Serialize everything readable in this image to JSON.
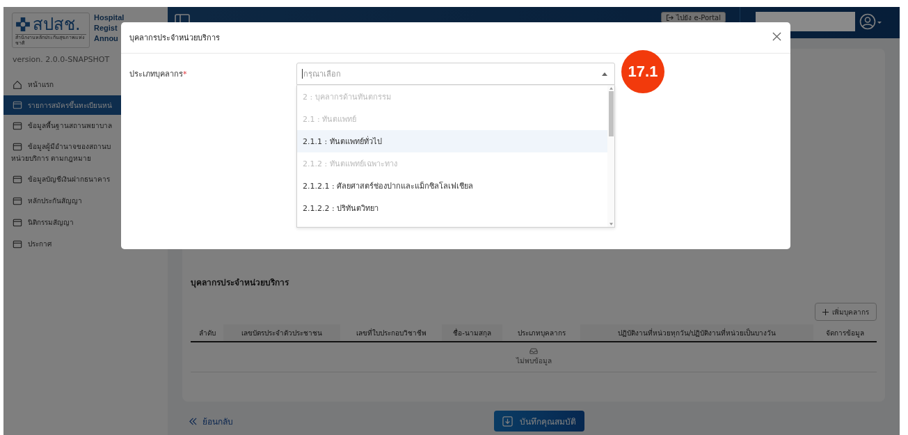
{
  "sidebar": {
    "logo_text": "สปสช.",
    "logo_subtitle": "สำนักงานหลักประกันสุขภาพแห่งชาติ",
    "app_title_lines": [
      "Hospital",
      "Regist",
      "Annou"
    ],
    "version": "version. 2.0.0-SNAPSHOT",
    "items": [
      {
        "kind": "home",
        "label": "หน้าแรก",
        "selected": false
      },
      {
        "kind": "page",
        "label": "รายการสมัครขึ้นทะเบียนหน่",
        "selected": true
      },
      {
        "kind": "page",
        "label": "ข้อมูลพื้นฐานสถานพยาบาล",
        "selected": false
      },
      {
        "kind": "page",
        "label": "ข้อมูลผู้มีอำนาจของสถานบ",
        "label_2": "หน่วยบริการ ตามกฎหมาย",
        "selected": false
      },
      {
        "kind": "page",
        "label": "ข้อมูลบัญชีเงินฝากธนาคาร",
        "selected": false
      },
      {
        "kind": "page",
        "label": "หลักประกันสัญญา",
        "selected": false
      },
      {
        "kind": "page",
        "label": "นิติกรรมสัญญา",
        "selected": false
      },
      {
        "kind": "page",
        "label": "ประกาศ",
        "selected": false
      }
    ]
  },
  "header": {
    "portal_button": "ไปยัง e-Portal"
  },
  "page": {
    "section_title": "บุคลากรประจำหน่วยบริการ",
    "add_button": "เพิ่มบุคลากร",
    "table": {
      "columns": [
        "ลำดับ",
        "เลขบัตรประจำตัวประชาชน",
        "เลขที่ใบประกอบวิชาชีพ",
        "ชื่อ-นามสกุล",
        "ประเภทบุคลากร",
        "ปฏิบัติงานที่หน่วยทุกวัน/ปฏิบัติงานที่หน่วยเป็นบางวัน",
        "จัดการข้อมูล"
      ],
      "empty_text": "ไม่พบข้อมูล"
    },
    "back_link": "ย้อนกลับ",
    "save_button": "บันทึกคุณสมบัติ"
  },
  "modal": {
    "title": "บุคลากรประจำหน่วยบริการ",
    "field": {
      "label": "ประเภทบุคลากร",
      "required_mark": "*",
      "placeholder": "กรุณาเลือก",
      "expanded": true,
      "options": [
        {
          "label": "2 : บุคลากรด้านทันตกรรม",
          "disabled": true,
          "highlighted": false
        },
        {
          "label": "2.1 : ทันตแพทย์",
          "disabled": true,
          "highlighted": false
        },
        {
          "label": "2.1.1 : ทันตแพทย์ทั่วไป",
          "disabled": false,
          "highlighted": true
        },
        {
          "label": "2.1.2 : ทันตแพทย์เฉพาะทาง",
          "disabled": true,
          "highlighted": false
        },
        {
          "label": "2.1.2.1 : ศัลยศาสตร์ช่องปากและแม็กซิลโลเฟเชียล",
          "disabled": false,
          "highlighted": false
        },
        {
          "label": "2.1.2.2 : ปริทันตวิทยา",
          "disabled": false,
          "highlighted": false
        }
      ]
    }
  },
  "annotation": {
    "badge": "17.1"
  }
}
